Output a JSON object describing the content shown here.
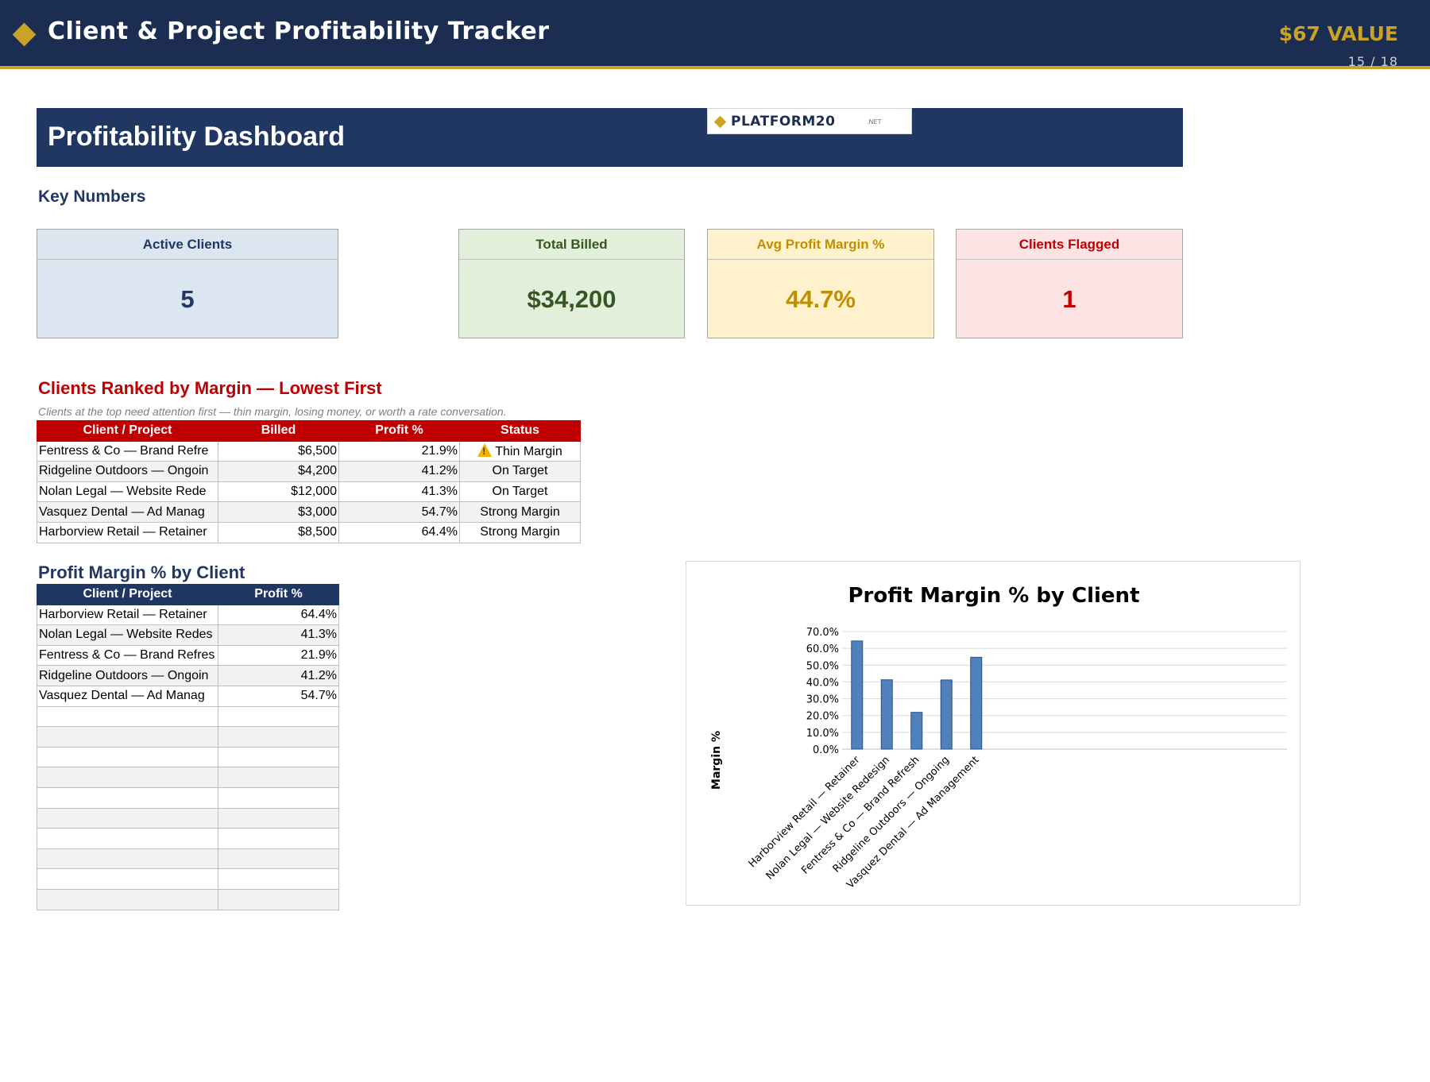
{
  "header": {
    "title": "Client & Project Profitability Tracker",
    "value_badge": "$67 VALUE",
    "page_indicator": "15 / 18",
    "accent_color": "#c9a227",
    "bar_color": "#1c2d52"
  },
  "dashboard": {
    "title": "Profitability Dashboard",
    "logo_text": "PLATFORM20",
    "logo_suffix": ".NET"
  },
  "key_numbers": {
    "label": "Key Numbers",
    "cards": [
      {
        "label": "Active Clients",
        "value": "5"
      },
      {
        "label": "Total Billed",
        "value": "$34,200"
      },
      {
        "label": "Avg Profit Margin %",
        "value": "44.7%"
      },
      {
        "label": "Clients Flagged",
        "value": "1"
      }
    ]
  },
  "ranked": {
    "title": "Clients Ranked by Margin — Lowest First",
    "subtitle": "Clients at the top need attention first — thin margin, losing money, or worth a rate conversation.",
    "columns": [
      "Client / Project",
      "Billed",
      "Profit %",
      "Status"
    ],
    "rows": [
      {
        "client": "Fentress & Co — Brand Refre",
        "billed": "$6,500",
        "profit": "21.9%",
        "status": "Thin Margin",
        "icon": "warning-icon"
      },
      {
        "client": "Ridgeline Outdoors — Ongoin",
        "billed": "$4,200",
        "profit": "41.2%",
        "status": "On Target"
      },
      {
        "client": "Nolan Legal — Website Rede",
        "billed": "$12,000",
        "profit": "41.3%",
        "status": "On Target"
      },
      {
        "client": "Vasquez Dental — Ad Manag",
        "billed": "$3,000",
        "profit": "54.7%",
        "status": "Strong Margin"
      },
      {
        "client": "Harborview Retail — Retainer",
        "billed": "$8,500",
        "profit": "64.4%",
        "status": "Strong Margin"
      }
    ]
  },
  "margin_table": {
    "title": "Profit Margin % by Client",
    "columns": [
      "Client / Project",
      "Profit %"
    ],
    "rows": [
      {
        "client": "Harborview Retail — Retainer",
        "profit": "64.4%"
      },
      {
        "client": "Nolan Legal — Website Redes",
        "profit": "41.3%"
      },
      {
        "client": "Fentress & Co — Brand Refres",
        "profit": "21.9%"
      },
      {
        "client": "Ridgeline Outdoors — Ongoin",
        "profit": "41.2%"
      },
      {
        "client": "Vasquez Dental — Ad Manag",
        "profit": "54.7%"
      }
    ]
  },
  "chart_data": {
    "type": "bar",
    "title": "Profit Margin % by Client",
    "xlabel": "",
    "ylabel": "Margin %",
    "categories": [
      "Harborview Retail — Retainer",
      "Nolan Legal — Website Redesign",
      "Fentress & Co — Brand Refresh",
      "Ridgeline Outdoors — Ongoing",
      "Vasquez Dental — Ad Management"
    ],
    "values": [
      64.4,
      41.3,
      21.9,
      41.2,
      54.7
    ],
    "ylim": [
      0,
      70
    ],
    "y_ticks": [
      "0.0%",
      "10.0%",
      "20.0%",
      "30.0%",
      "40.0%",
      "50.0%",
      "60.0%",
      "70.0%"
    ],
    "grid": true,
    "legend": "none",
    "bar_color": "#4f81bd"
  }
}
